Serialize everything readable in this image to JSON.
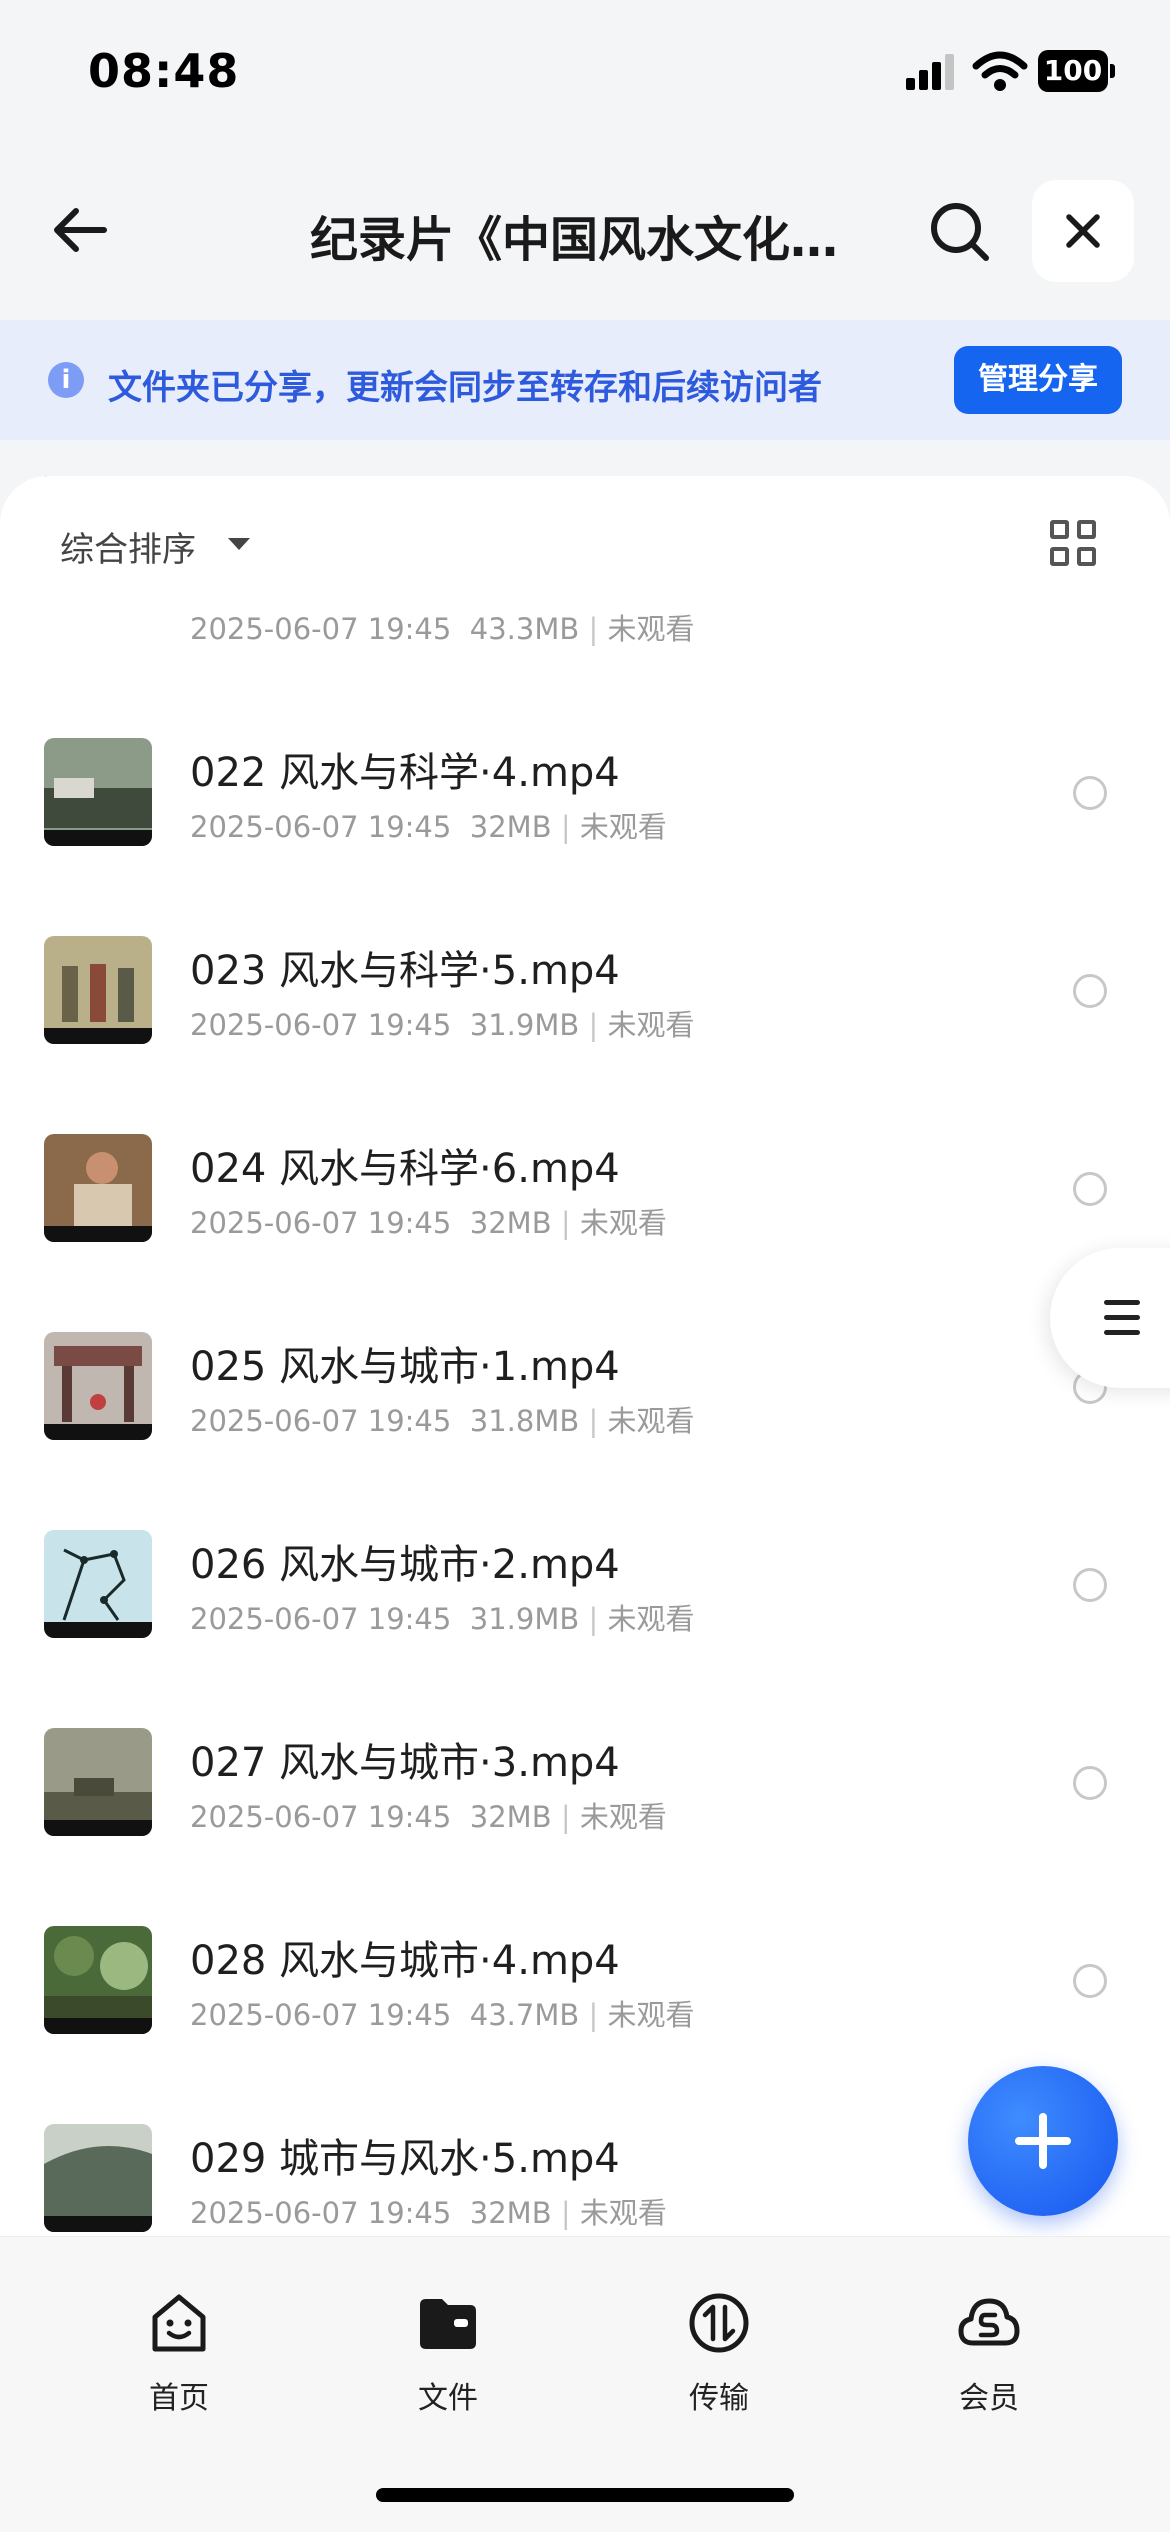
{
  "status_bar": {
    "time": "08:48",
    "battery": "100"
  },
  "header": {
    "title": "纪录片《中国风水文化…"
  },
  "share_notice": {
    "text": "文件夹已分享，更新会同步至转存和后续访问者",
    "button_label": "管理分享"
  },
  "sort": {
    "label": "综合排序"
  },
  "files": [
    {
      "name": "",
      "date": "2025-06-07 19:45",
      "size": "43.3MB",
      "status": "未观看",
      "thumb_colors": [
        "#a05a2a",
        "#3a1a0a"
      ]
    },
    {
      "name": "022 风水与科学·4.mp4",
      "date": "2025-06-07 19:45",
      "size": "32MB",
      "status": "未观看",
      "thumb_colors": [
        "#8c9a88",
        "#404a3c"
      ]
    },
    {
      "name": "023 风水与科学·5.mp4",
      "date": "2025-06-07 19:45",
      "size": "31.9MB",
      "status": "未观看",
      "thumb_colors": [
        "#b9b08a",
        "#6a6248"
      ]
    },
    {
      "name": "024 风水与科学·6.mp4",
      "date": "2025-06-07 19:45",
      "size": "32MB",
      "status": "未观看",
      "thumb_colors": [
        "#8a6a4a",
        "#d8c8b0"
      ]
    },
    {
      "name": "025 风水与城市·1.mp4",
      "date": "2025-06-07 19:45",
      "size": "31.8MB",
      "status": "未观看",
      "thumb_colors": [
        "#7a4a44",
        "#c0b8b0"
      ]
    },
    {
      "name": "026 风水与城市·2.mp4",
      "date": "2025-06-07 19:45",
      "size": "31.9MB",
      "status": "未观看",
      "thumb_colors": [
        "#c8e4ea",
        "#a8d0d8"
      ]
    },
    {
      "name": "027 风水与城市·3.mp4",
      "date": "2025-06-07 19:45",
      "size": "32MB",
      "status": "未观看",
      "thumb_colors": [
        "#9a9a88",
        "#5a5a48"
      ]
    },
    {
      "name": "028 风水与城市·4.mp4",
      "date": "2025-06-07 19:45",
      "size": "43.7MB",
      "status": "未观看",
      "thumb_colors": [
        "#4a6a3a",
        "#9ab880"
      ]
    },
    {
      "name": "029 城市与风水·5.mp4",
      "date": "2025-06-07 19:45",
      "size": "32MB",
      "status": "未观看",
      "thumb_colors": [
        "#5a6a5a",
        "#c8d0c8"
      ]
    }
  ],
  "bottom_nav": [
    {
      "label": "首页",
      "icon": "home-face-icon"
    },
    {
      "label": "文件",
      "icon": "folder-icon"
    },
    {
      "label": "传输",
      "icon": "transfer-icon"
    },
    {
      "label": "会员",
      "icon": "vip-cloud-icon"
    }
  ]
}
